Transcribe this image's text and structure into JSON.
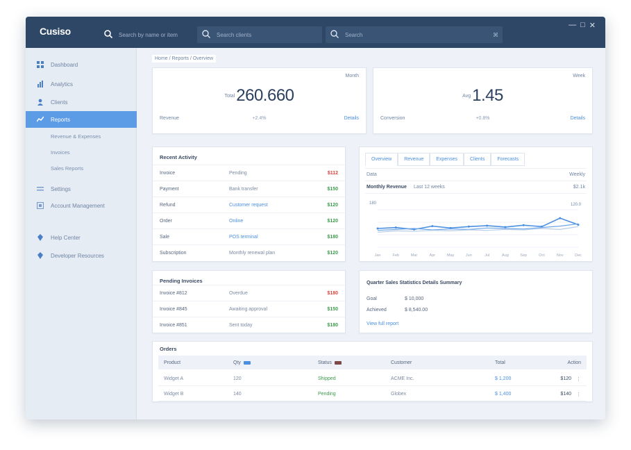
{
  "app": {
    "logo": "Cusiso",
    "window_controls": [
      "—",
      "□",
      "✕"
    ]
  },
  "topbar": {
    "search1": {
      "icon": "search-icon",
      "placeholder": "Search by name or item"
    },
    "search2": {
      "icon": "search-icon",
      "placeholder": "Search clients"
    },
    "search3": {
      "icon": "search-icon",
      "placeholder": "Search",
      "shortcut": "⌘"
    }
  },
  "sidebar": {
    "items": [
      {
        "label": "Dashboard",
        "icon": "dashboard-icon",
        "active": false
      },
      {
        "label": "Analytics",
        "icon": "chart-icon",
        "active": false
      },
      {
        "label": "Clients",
        "icon": "user-icon",
        "active": false
      },
      {
        "label": "Reports",
        "icon": "report-icon",
        "active": true
      },
      {
        "label": "Revenue & Expenses",
        "sub": true
      },
      {
        "label": "Invoices",
        "sub": true
      },
      {
        "label": "Sales Reports",
        "sub": true
      },
      {
        "label": "Settings",
        "icon": "settings-icon",
        "active": false
      },
      {
        "label": "Account Management",
        "icon": "account-icon",
        "active": false
      },
      {
        "label": "Help Center",
        "icon": "help-icon",
        "active": false
      },
      {
        "label": "Developer Resources",
        "icon": "code-icon",
        "active": false
      }
    ]
  },
  "main": {
    "breadcrumb": "Home / Reports / Overview",
    "kpi1": {
      "corner": "Month",
      "prefix": "Total",
      "value": "260.660",
      "bottom_left": "Revenue",
      "bottom_mid": "+2.4%",
      "bottom_right": "Details"
    },
    "kpi2": {
      "corner": "Week",
      "prefix": "Avg",
      "value": "1.45",
      "bottom_left": "Conversion",
      "bottom_mid": "+0.8%",
      "bottom_right": "Details"
    },
    "transactions": {
      "title": "Recent Activity",
      "rows": [
        {
          "name": "Invoice",
          "detail": "Pending",
          "amount": "$112",
          "status": "red"
        },
        {
          "name": "Payment",
          "detail": "Bank transfer",
          "amount": "$150",
          "status": "green"
        },
        {
          "name": "Refund",
          "detail": "Customer request",
          "amount": "$120",
          "status": "green",
          "link": true
        },
        {
          "name": "Order",
          "detail": "Online",
          "amount": "$120",
          "status": "green",
          "link": true
        },
        {
          "name": "Sale",
          "detail": "POS terminal",
          "amount": "$180",
          "status": "green",
          "link": true
        },
        {
          "name": "Subscription",
          "detail": "Monthly renewal plan",
          "amount": "$120",
          "status": "green"
        }
      ]
    },
    "chart_panel": {
      "tabs": [
        "Overview",
        "Revenue",
        "Expenses",
        "Clients",
        "Forecasts"
      ],
      "row1_left": "Data",
      "row1_right": "Weekly",
      "row2_left": "Monthly Revenue",
      "row2_mid": "Last 12 weeks",
      "row2_right": "$2.1k",
      "y_label_left": "180",
      "y_label_right": "120.0"
    },
    "chart_data": {
      "type": "line",
      "x": [
        "Jan",
        "Feb",
        "Mar",
        "Apr",
        "May",
        "Jun",
        "Jul",
        "Aug",
        "Sep",
        "Oct",
        "Nov",
        "Dec"
      ],
      "series": [
        {
          "values": [
            40,
            42,
            38,
            45,
            41,
            44,
            46,
            43,
            47,
            44,
            62,
            48
          ]
        },
        {
          "values": [
            36,
            38,
            40,
            37,
            39,
            38,
            41,
            40,
            39,
            42,
            45,
            50
          ]
        },
        {
          "values": [
            32,
            35,
            34,
            36,
            35,
            37,
            36,
            38,
            37,
            40,
            38,
            44
          ]
        }
      ],
      "ylim": [
        0,
        80
      ],
      "colors": [
        "#4a8fe0",
        "#6fa6e6",
        "#b6cce8"
      ]
    },
    "summary": {
      "title": "Pending Invoices",
      "rows": [
        {
          "name": "Invoice #812",
          "detail": "Overdue",
          "amount": "$180",
          "status": "red"
        },
        {
          "name": "Invoice #845",
          "detail": "Awaiting approval",
          "amount": "$150",
          "status": "green"
        },
        {
          "name": "Invoice #851",
          "detail": "Sent today",
          "amount": "$180",
          "status": "green"
        }
      ]
    },
    "info": {
      "title": "Quarter Sales Statistics Details Summary",
      "line1_left": "Goal",
      "line1_right": "$ 10,000",
      "line2_left": "Achieved",
      "line2_right": "$ 8,540.00",
      "link": "View full report"
    },
    "table": {
      "title": "Orders",
      "headers": [
        "Product",
        "Qty",
        "Status",
        "Customer",
        "Total",
        "Action"
      ],
      "rows": [
        {
          "product": "Widget A",
          "qty": "120",
          "status": "Shipped",
          "customer": "ACME Inc.",
          "total": "$ 1,200",
          "amount": "$120",
          "action": "⋮"
        },
        {
          "product": "Widget B",
          "qty": "140",
          "status": "Pending",
          "customer": "Globex",
          "total": "$ 1,400",
          "amount": "$140",
          "action": "⋮"
        }
      ]
    }
  }
}
